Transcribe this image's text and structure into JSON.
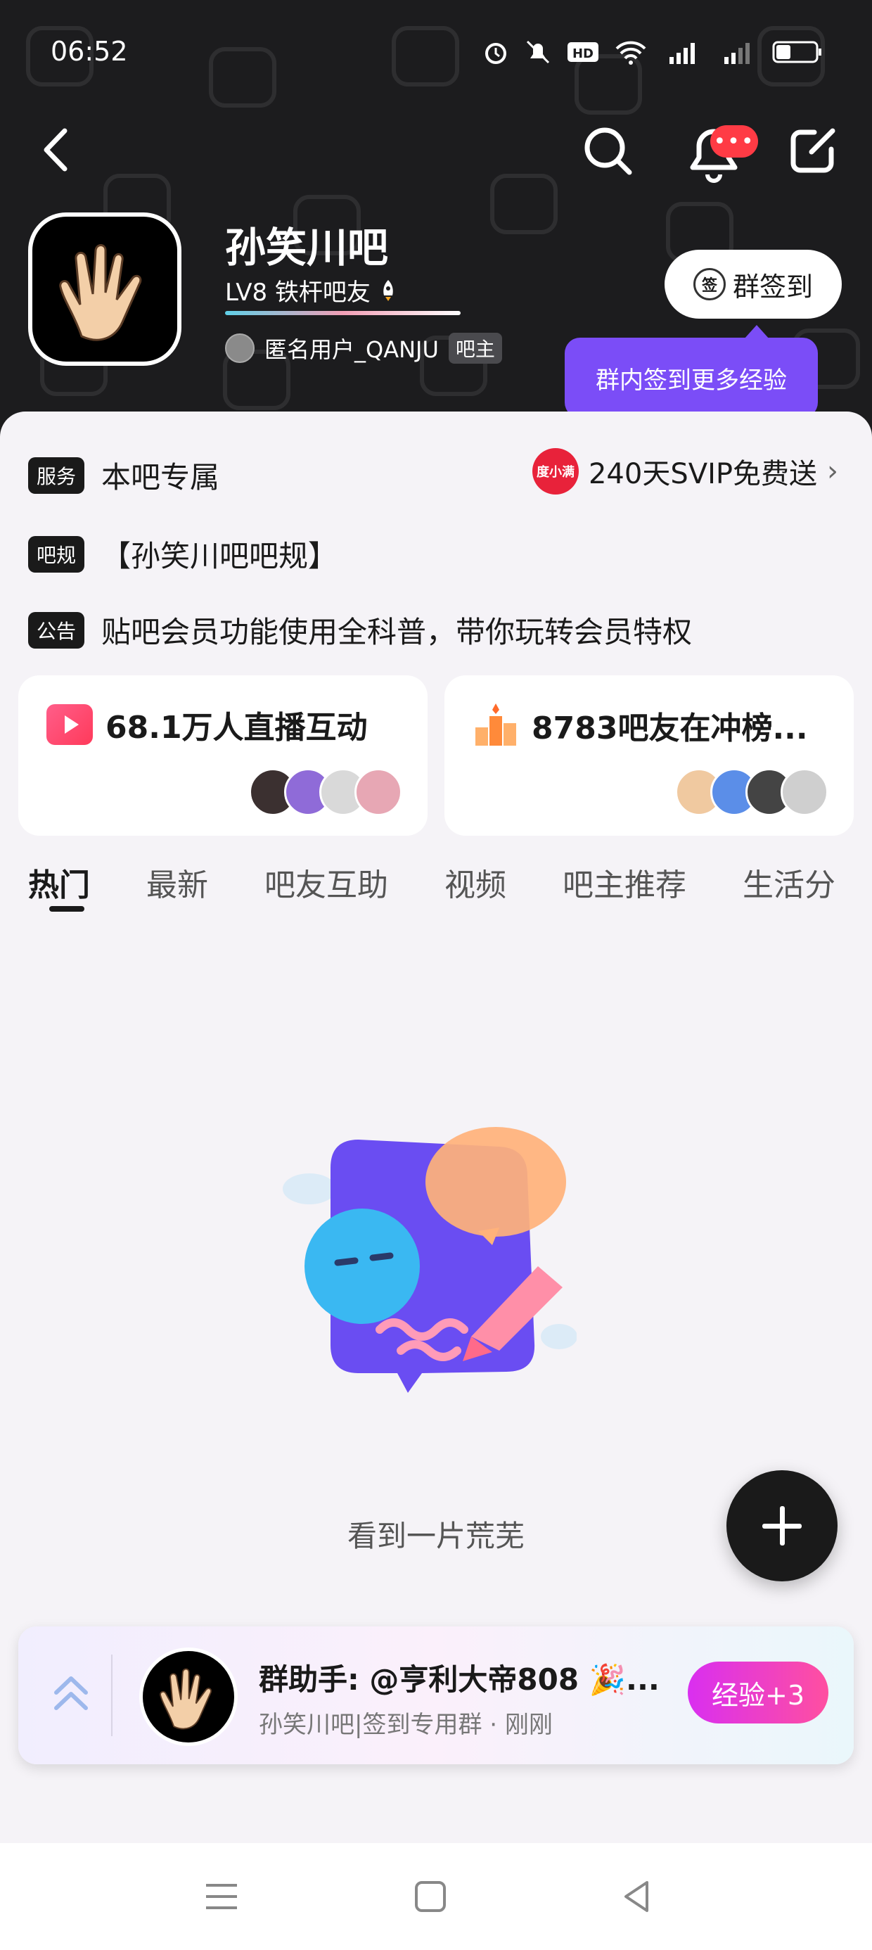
{
  "status_bar": {
    "time": "06:52",
    "battery": "29"
  },
  "header": {
    "forum_name": "孙笑川吧",
    "level_text": "LV8 铁杆吧友",
    "owner_name": "匿名用户_QANJU",
    "owner_badge": "吧主",
    "notification_badge": "•••",
    "checkin_icon_text": "签",
    "checkin_label": "群签到",
    "tooltip": "群内签到更多经验"
  },
  "info": {
    "service_tag": "服务",
    "service_text": "本吧专属",
    "svip_logo": "度小满",
    "svip_text": "240天SVIP免费送",
    "rules_tag": "吧规",
    "rules_text": "【孙笑川吧吧规】",
    "notice_tag": "公告",
    "notice_text": "贴吧会员功能使用全科普，带你玩转会员特权"
  },
  "stats": {
    "live": "68.1万人直播互动",
    "rank": "8783吧友在冲榜..."
  },
  "tabs": [
    "热门",
    "最新",
    "吧友互助",
    "视频",
    "吧主推荐",
    "生活分"
  ],
  "empty_text": "看到一片荒芜",
  "notification": {
    "title": "群助手: @亨利大帝808 🎉...",
    "subtitle": "孙笑川吧|签到专用群 · 刚刚",
    "button": "经验+3"
  },
  "colors": {
    "header_bg": "#1c1c1e",
    "accent_purple": "#7b4df7",
    "badge_red": "#ff3b45",
    "exp_gradient_start": "#d92ff0",
    "exp_gradient_end": "#ff4fa0"
  }
}
